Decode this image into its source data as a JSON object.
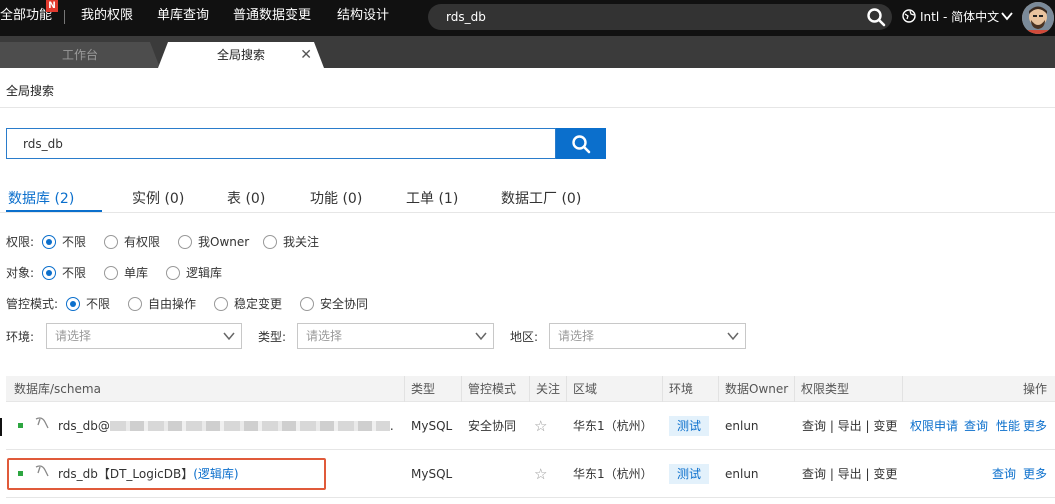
{
  "topnav": {
    "items": [
      "全部功能",
      "我的权限",
      "单库查询",
      "普通数据变更",
      "结构设计"
    ],
    "badge": "N",
    "search_value": "rds_db",
    "language": "Intl - 简体中文"
  },
  "tabs": [
    {
      "label": "工作台"
    },
    {
      "label": "全局搜索"
    }
  ],
  "page_title": "全局搜索",
  "search": {
    "value": "rds_db"
  },
  "categories": [
    {
      "label": "数据库 (2)"
    },
    {
      "label": "实例 (0)"
    },
    {
      "label": "表 (0)"
    },
    {
      "label": "功能 (0)"
    },
    {
      "label": "工单 (1)"
    },
    {
      "label": "数据工厂 (0)"
    }
  ],
  "filters": {
    "permission": {
      "label": "权限:",
      "options": [
        "不限",
        "有权限",
        "我Owner",
        "我关注"
      ],
      "selected": "不限"
    },
    "object": {
      "label": "对象:",
      "options": [
        "不限",
        "单库",
        "逻辑库"
      ],
      "selected": "不限"
    },
    "control": {
      "label": "管控模式:",
      "options": [
        "不限",
        "自由操作",
        "稳定变更",
        "安全协同"
      ],
      "selected": "不限"
    },
    "env": {
      "label": "环境:",
      "placeholder": "请选择"
    },
    "type": {
      "label": "类型:",
      "placeholder": "请选择"
    },
    "region": {
      "label": "地区:",
      "placeholder": "请选择"
    }
  },
  "table": {
    "headers": [
      "数据库/schema",
      "类型",
      "管控模式",
      "关注",
      "区域",
      "环境",
      "数据Owner",
      "权限类型",
      "操作"
    ],
    "rows": [
      {
        "name": "rds_db@",
        "name_suffix": ".",
        "type": "MySQL",
        "control": "安全协同",
        "region": "华东1（杭州）",
        "env": "测试",
        "owner": "enlun",
        "perms": "查询 | 导出 | 变更",
        "actions": [
          "权限申请",
          "查询",
          "性能",
          "更多"
        ]
      },
      {
        "name": "rds_db【DT_LogicDB】",
        "logic_tag": "(逻辑库)",
        "type": "MySQL",
        "control": "",
        "region": "华东1（杭州）",
        "env": "测试",
        "owner": "enlun",
        "perms": "查询 | 导出 | 变更",
        "actions": [
          "查询",
          "更多"
        ]
      }
    ]
  },
  "colors": {
    "accent": "#0b6fcc",
    "topbar": "#111111",
    "highlight": "#e05a3a",
    "status_ok": "#2da641"
  }
}
